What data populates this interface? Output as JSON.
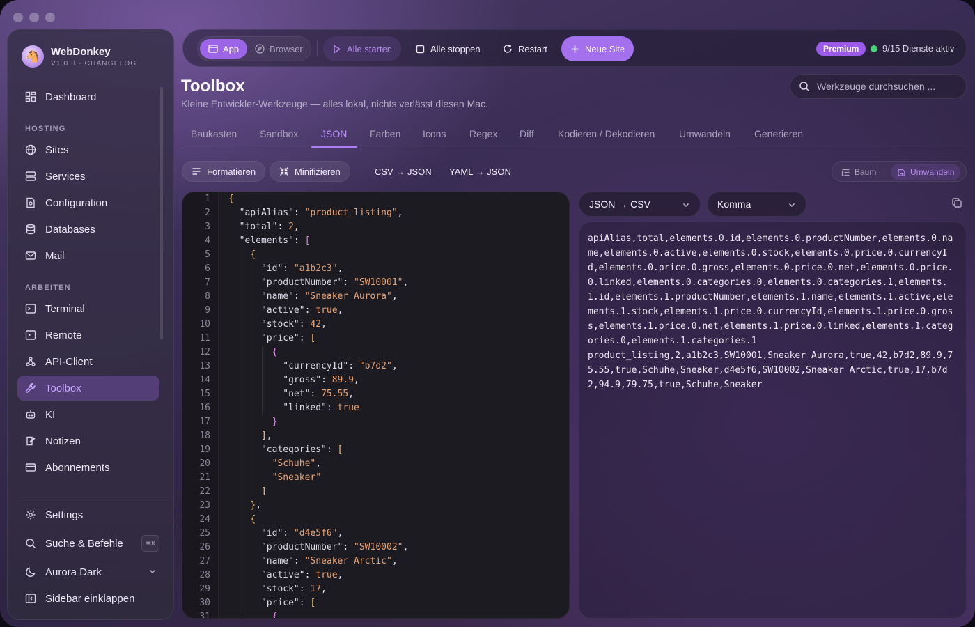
{
  "app": {
    "name": "WebDonkey",
    "version": "V1.0.0 · CHANGELOG"
  },
  "sidebar": {
    "top": [
      {
        "label": "Dashboard",
        "icon": "dashboard-icon"
      }
    ],
    "hosting_title": "HOSTING",
    "hosting": [
      {
        "label": "Sites",
        "icon": "globe-icon"
      },
      {
        "label": "Services",
        "icon": "server-icon"
      },
      {
        "label": "Configuration",
        "icon": "config-file-icon"
      },
      {
        "label": "Databases",
        "icon": "database-icon"
      },
      {
        "label": "Mail",
        "icon": "mail-icon"
      }
    ],
    "work_title": "ARBEITEN",
    "work": [
      {
        "label": "Terminal",
        "icon": "terminal-icon"
      },
      {
        "label": "Remote",
        "icon": "remote-icon"
      },
      {
        "label": "API-Client",
        "icon": "api-icon"
      },
      {
        "label": "Toolbox",
        "icon": "wrench-icon",
        "active": true
      },
      {
        "label": "KI",
        "icon": "robot-icon"
      },
      {
        "label": "Notizen",
        "icon": "notes-icon"
      },
      {
        "label": "Abonnements",
        "icon": "card-icon"
      }
    ],
    "bottom": {
      "settings": "Settings",
      "search": "Suche & Befehle",
      "search_kbd": "⌘K",
      "theme": "Aurora Dark",
      "collapse": "Sidebar einklappen"
    }
  },
  "topbar": {
    "mode_app": "App",
    "mode_browser": "Browser",
    "start_all": "Alle starten",
    "stop_all": "Alle stoppen",
    "restart": "Restart",
    "new_site": "Neue Site",
    "premium": "Premium",
    "services_status": "9/15 Dienste aktiv"
  },
  "header": {
    "title": "Toolbox",
    "subtitle": "Kleine Entwickler-Werkzeuge — alles lokal, nichts verlässt diesen Mac.",
    "search_placeholder": "Werkzeuge durchsuchen ..."
  },
  "tabs": [
    "Baukasten",
    "Sandbox",
    "JSON",
    "Farben",
    "Icons",
    "Regex",
    "Diff",
    "Kodieren / Dekodieren",
    "Umwandeln",
    "Generieren"
  ],
  "active_tab": "JSON",
  "toolbar": {
    "format": "Formatieren",
    "minify": "Minifizieren",
    "csv_json": "CSV → JSON",
    "yaml_json": "YAML → JSON",
    "tree": "Baum",
    "convert": "Umwandeln"
  },
  "output": {
    "mode": "JSON → CSV",
    "delimiter": "Komma",
    "text": "apiAlias,total,elements.0.id,elements.0.productNumber,elements.0.name,elements.0.active,elements.0.stock,elements.0.price.0.currencyId,elements.0.price.0.gross,elements.0.price.0.net,elements.0.price.0.linked,elements.0.categories.0,elements.0.categories.1,elements.1.id,elements.1.productNumber,elements.1.name,elements.1.active,elements.1.stock,elements.1.price.0.currencyId,elements.1.price.0.gross,elements.1.price.0.net,elements.1.price.0.linked,elements.1.categories.0,elements.1.categories.1\nproduct_listing,2,a1b2c3,SW10001,Sneaker Aurora,true,42,b7d2,89.9,75.55,true,Schuhe,Sneaker,d4e5f6,SW10002,Sneaker Arctic,true,17,b7d2,94.9,79.75,true,Schuhe,Sneaker"
  },
  "editor_lines": [
    [
      [
        "br",
        "{"
      ]
    ],
    [
      [
        "",
        "  "
      ],
      [
        "k",
        "\"apiAlias\""
      ],
      [
        "",
        ": "
      ],
      [
        "s",
        "\"product_listing\""
      ],
      [
        "",
        ","
      ]
    ],
    [
      [
        "",
        "  "
      ],
      [
        "k",
        "\"total\""
      ],
      [
        "",
        ": "
      ],
      [
        "n",
        "2"
      ],
      [
        "",
        ","
      ]
    ],
    [
      [
        "",
        "  "
      ],
      [
        "k",
        "\"elements\""
      ],
      [
        "",
        ": "
      ],
      [
        "br2",
        "["
      ]
    ],
    [
      [
        "",
        "    "
      ],
      [
        "br",
        "{"
      ]
    ],
    [
      [
        "",
        "      "
      ],
      [
        "k",
        "\"id\""
      ],
      [
        "",
        ": "
      ],
      [
        "s",
        "\"a1b2c3\""
      ],
      [
        "",
        ","
      ]
    ],
    [
      [
        "",
        "      "
      ],
      [
        "k",
        "\"productNumber\""
      ],
      [
        "",
        ": "
      ],
      [
        "s",
        "\"SW10001\""
      ],
      [
        "",
        ","
      ]
    ],
    [
      [
        "",
        "      "
      ],
      [
        "k",
        "\"name\""
      ],
      [
        "",
        ": "
      ],
      [
        "s",
        "\"Sneaker Aurora\""
      ],
      [
        "",
        ","
      ]
    ],
    [
      [
        "",
        "      "
      ],
      [
        "k",
        "\"active\""
      ],
      [
        "",
        ": "
      ],
      [
        "b",
        "true"
      ],
      [
        "",
        ","
      ]
    ],
    [
      [
        "",
        "      "
      ],
      [
        "k",
        "\"stock\""
      ],
      [
        "",
        ": "
      ],
      [
        "n",
        "42"
      ],
      [
        "",
        ","
      ]
    ],
    [
      [
        "",
        "      "
      ],
      [
        "k",
        "\"price\""
      ],
      [
        "",
        ": "
      ],
      [
        "br",
        "["
      ]
    ],
    [
      [
        "",
        "        "
      ],
      [
        "br2",
        "{"
      ]
    ],
    [
      [
        "",
        "          "
      ],
      [
        "k",
        "\"currencyId\""
      ],
      [
        "",
        ": "
      ],
      [
        "s",
        "\"b7d2\""
      ],
      [
        "",
        ","
      ]
    ],
    [
      [
        "",
        "          "
      ],
      [
        "k",
        "\"gross\""
      ],
      [
        "",
        ": "
      ],
      [
        "n",
        "89.9"
      ],
      [
        "",
        ","
      ]
    ],
    [
      [
        "",
        "          "
      ],
      [
        "k",
        "\"net\""
      ],
      [
        "",
        ": "
      ],
      [
        "n",
        "75.55"
      ],
      [
        "",
        ","
      ]
    ],
    [
      [
        "",
        "          "
      ],
      [
        "k",
        "\"linked\""
      ],
      [
        "",
        ": "
      ],
      [
        "b",
        "true"
      ]
    ],
    [
      [
        "",
        "        "
      ],
      [
        "br2",
        "}"
      ]
    ],
    [
      [
        "",
        "      "
      ],
      [
        "br",
        "]"
      ],
      [
        "",
        ","
      ]
    ],
    [
      [
        "",
        "      "
      ],
      [
        "k",
        "\"categories\""
      ],
      [
        "",
        ": "
      ],
      [
        "br",
        "["
      ]
    ],
    [
      [
        "",
        "        "
      ],
      [
        "s",
        "\"Schuhe\""
      ],
      [
        "",
        ","
      ]
    ],
    [
      [
        "",
        "        "
      ],
      [
        "s",
        "\"Sneaker\""
      ]
    ],
    [
      [
        "",
        "      "
      ],
      [
        "br",
        "]"
      ]
    ],
    [
      [
        "",
        "    "
      ],
      [
        "br",
        "}"
      ],
      [
        "",
        ","
      ]
    ],
    [
      [
        "",
        "    "
      ],
      [
        "br",
        "{"
      ]
    ],
    [
      [
        "",
        "      "
      ],
      [
        "k",
        "\"id\""
      ],
      [
        "",
        ": "
      ],
      [
        "s",
        "\"d4e5f6\""
      ],
      [
        "",
        ","
      ]
    ],
    [
      [
        "",
        "      "
      ],
      [
        "k",
        "\"productNumber\""
      ],
      [
        "",
        ": "
      ],
      [
        "s",
        "\"SW10002\""
      ],
      [
        "",
        ","
      ]
    ],
    [
      [
        "",
        "      "
      ],
      [
        "k",
        "\"name\""
      ],
      [
        "",
        ": "
      ],
      [
        "s",
        "\"Sneaker Arctic\""
      ],
      [
        "",
        ","
      ]
    ],
    [
      [
        "",
        "      "
      ],
      [
        "k",
        "\"active\""
      ],
      [
        "",
        ": "
      ],
      [
        "b",
        "true"
      ],
      [
        "",
        ","
      ]
    ],
    [
      [
        "",
        "      "
      ],
      [
        "k",
        "\"stock\""
      ],
      [
        "",
        ": "
      ],
      [
        "n",
        "17"
      ],
      [
        "",
        ","
      ]
    ],
    [
      [
        "",
        "      "
      ],
      [
        "k",
        "\"price\""
      ],
      [
        "",
        ": "
      ],
      [
        "br",
        "["
      ]
    ],
    [
      [
        "",
        "        "
      ],
      [
        "br2",
        "{"
      ]
    ]
  ],
  "colors": {
    "accent": "#9c64e6",
    "active_nav": "#c9a6ff",
    "status_dot": "#4cd07a",
    "json_string": "#e8a374"
  }
}
